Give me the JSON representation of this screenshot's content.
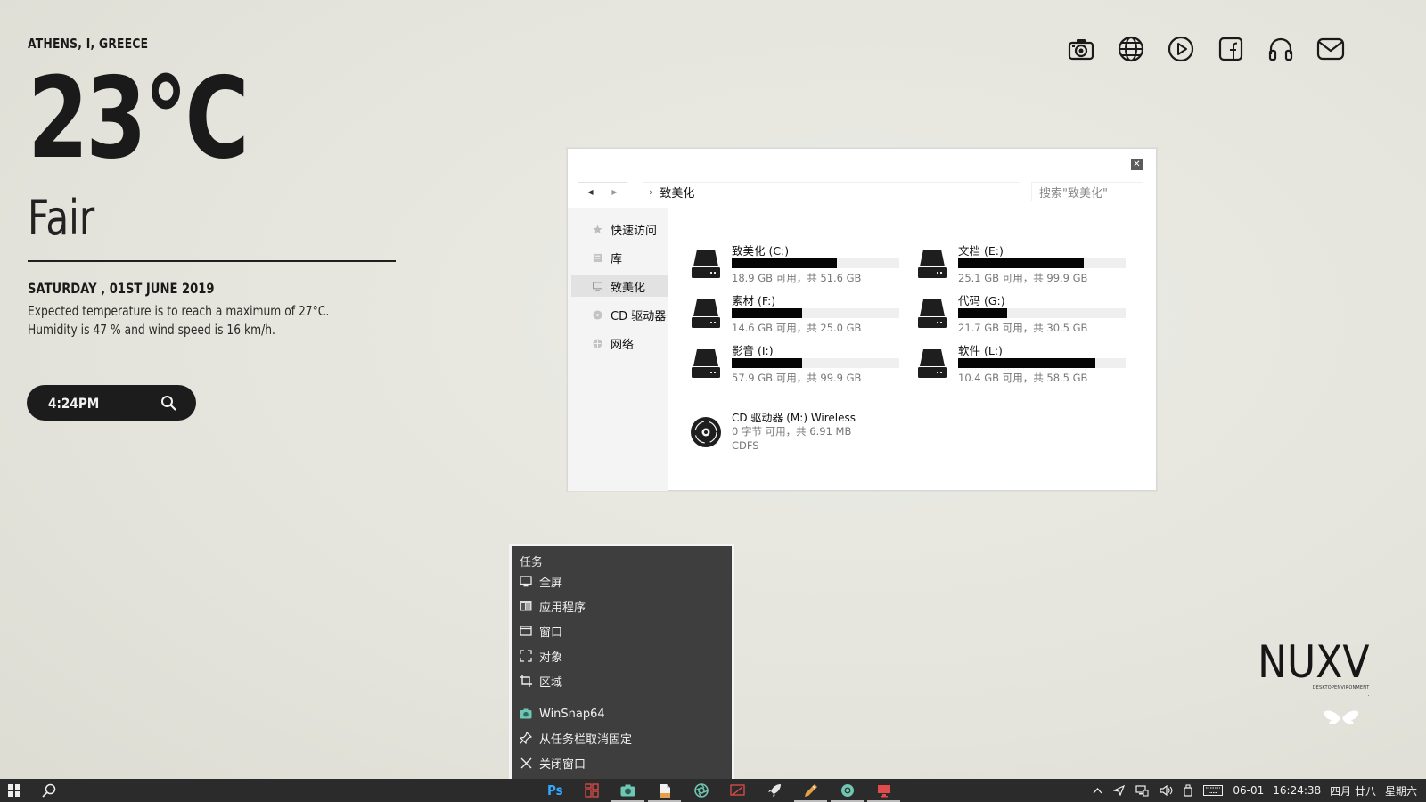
{
  "weather": {
    "location": "ATHENS, I, GREECE",
    "temperature": "23°C",
    "condition": "Fair",
    "date": "SATURDAY , 01ST JUNE 2019",
    "line1": "Expected temperature is to reach a maximum of 27°C.",
    "line2": "Humidity is 47 % and wind speed is 16 km/h.",
    "time": "4:24PM"
  },
  "top_icons": [
    "camera-icon",
    "globe-icon",
    "play-icon",
    "facebook-icon",
    "headphones-icon",
    "mail-icon"
  ],
  "explorer": {
    "path": "致美化",
    "search_placeholder": "搜索\"致美化\"",
    "sidebar": [
      {
        "label": "快速访问",
        "icon": "star-icon"
      },
      {
        "label": "库",
        "icon": "library-icon"
      },
      {
        "label": "致美化",
        "icon": "computer-icon",
        "selected": true
      },
      {
        "label": "CD 驱动器",
        "icon": "cd-icon"
      },
      {
        "label": "网络",
        "icon": "network-icon"
      }
    ],
    "drives": [
      {
        "name": "致美化 (C:)",
        "info": "18.9 GB 可用，共 51.6 GB",
        "used": 0.63
      },
      {
        "name": "文档 (E:)",
        "info": "25.1 GB 可用，共 99.9 GB",
        "used": 0.75
      },
      {
        "name": "素材 (F:)",
        "info": "14.6 GB 可用，共 25.0 GB",
        "used": 0.42
      },
      {
        "name": "代码 (G:)",
        "info": "21.7 GB 可用，共 30.5 GB",
        "used": 0.29
      },
      {
        "name": "影音 (I:)",
        "info": "57.9 GB 可用，共 99.9 GB",
        "used": 0.42
      },
      {
        "name": "软件 (L:)",
        "info": "10.4 GB 可用，共 58.5 GB",
        "used": 0.82
      }
    ],
    "cd": {
      "name": "CD 驱动器 (M:) Wireless",
      "info": "0 字节 可用，共 6.91 MB",
      "fs": "CDFS"
    }
  },
  "context_menu": {
    "header": "任务",
    "items": [
      {
        "label": "全屏",
        "icon": "monitor-icon"
      },
      {
        "label": "应用程序",
        "icon": "app-window-icon"
      },
      {
        "label": "窗口",
        "icon": "window-icon"
      },
      {
        "label": "对象",
        "icon": "object-select-icon"
      },
      {
        "label": "区域",
        "icon": "crop-icon"
      },
      {
        "label": "WinSnap64",
        "icon": "winsnap-icon"
      },
      {
        "label": "从任务栏取消固定",
        "icon": "unpin-icon"
      },
      {
        "label": "关闭窗口",
        "icon": "close-icon"
      }
    ]
  },
  "logo": {
    "title": "NUXV",
    "subtitle": "DESKTOPENVIRONMENT"
  },
  "taskbar": {
    "ps_label": "Ps",
    "date": "06-01",
    "time": "16:24:38",
    "lunar": "四月 廿八",
    "weekday": "星期六"
  },
  "colors": {
    "taskbar": "#2b2b2b",
    "menu": "#3e3e3e",
    "accent_ps": "#31a8ff",
    "accent_red": "#e24b4b",
    "accent_teal": "#6fc6b2",
    "accent_orange": "#e7a04a"
  }
}
